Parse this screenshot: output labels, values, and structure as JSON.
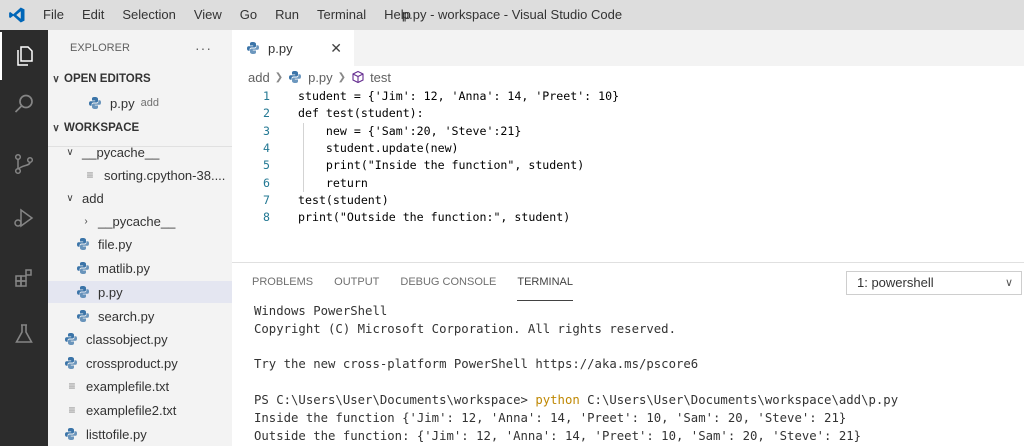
{
  "window": {
    "title": "p.py - workspace - Visual Studio Code"
  },
  "menu": [
    "File",
    "Edit",
    "Selection",
    "View",
    "Go",
    "Run",
    "Terminal",
    "Help"
  ],
  "activity": {
    "icons": [
      "explorer-icon",
      "search-icon",
      "source-control-icon",
      "run-debug-icon",
      "extensions-icon",
      "testing-icon"
    ],
    "colors": {
      "active": "#ffffff",
      "inactive": "#858585",
      "background": "#2c2c2c"
    }
  },
  "sidebar": {
    "header": "EXPLORER",
    "open_editors_label": "OPEN EDITORS",
    "open_file": {
      "name": "p.py",
      "folder": "add"
    },
    "workspace_label": "WORKSPACE",
    "tree": [
      {
        "label": "__pycache__",
        "type": "folder"
      },
      {
        "label": "sorting.cpython-38....",
        "type": "file"
      },
      {
        "label": "add",
        "type": "folder"
      },
      {
        "label": "__pycache__",
        "type": "folder-collapsed"
      },
      {
        "label": "file.py",
        "type": "py"
      },
      {
        "label": "matlib.py",
        "type": "py"
      },
      {
        "label": "p.py",
        "type": "py",
        "selected": true
      },
      {
        "label": "search.py",
        "type": "py"
      },
      {
        "label": "classobject.py",
        "type": "py"
      },
      {
        "label": "crossproduct.py",
        "type": "py"
      },
      {
        "label": "examplefile.txt",
        "type": "txt"
      },
      {
        "label": "examplefile2.txt",
        "type": "txt"
      },
      {
        "label": "listtofile.py",
        "type": "py"
      }
    ]
  },
  "editor": {
    "tab": {
      "label": "p.py",
      "close": "✕"
    },
    "breadcrumb": [
      "add",
      "p.py",
      "test"
    ],
    "lines": [
      {
        "num": "1",
        "text": "student = {'Jim': 12, 'Anna': 14, 'Preet': 10}"
      },
      {
        "num": "2",
        "text": "def test(student):"
      },
      {
        "num": "3",
        "text": "    new = {'Sam':20, 'Steve':21}"
      },
      {
        "num": "4",
        "text": "    student.update(new)"
      },
      {
        "num": "5",
        "text": "    print(\"Inside the function\", student)"
      },
      {
        "num": "6",
        "text": "    return"
      },
      {
        "num": "7",
        "text": "test(student)"
      },
      {
        "num": "8",
        "text": "print(\"Outside the function:\", student)"
      }
    ]
  },
  "panel": {
    "tabs": [
      "PROBLEMS",
      "OUTPUT",
      "DEBUG CONSOLE",
      "TERMINAL"
    ],
    "active_tab": "TERMINAL",
    "terminal_select": "1: powershell",
    "terminal": {
      "l1": "Windows PowerShell",
      "l2": "Copyright (C) Microsoft Corporation. All rights reserved.",
      "l3": "",
      "l4": "Try the new cross-platform PowerShell https://aka.ms/pscore6",
      "l5": "",
      "prompt": "PS C:\\Users\\User\\Documents\\workspace> ",
      "cmd": "python",
      "args": " C:\\Users\\User\\Documents\\workspace\\add\\p.py",
      "out1": "Inside the function {'Jim': 12, 'Anna': 14, 'Preet': 10, 'Sam': 20, 'Steve': 21}",
      "out2": "Outside the function: {'Jim': 12, 'Anna': 14, 'Preet': 10, 'Sam': 20, 'Steve': 21}"
    }
  },
  "colors": {
    "accent": "#0066b8",
    "python_blue": "#3b74a8",
    "python_yellow": "#f1c40f"
  }
}
